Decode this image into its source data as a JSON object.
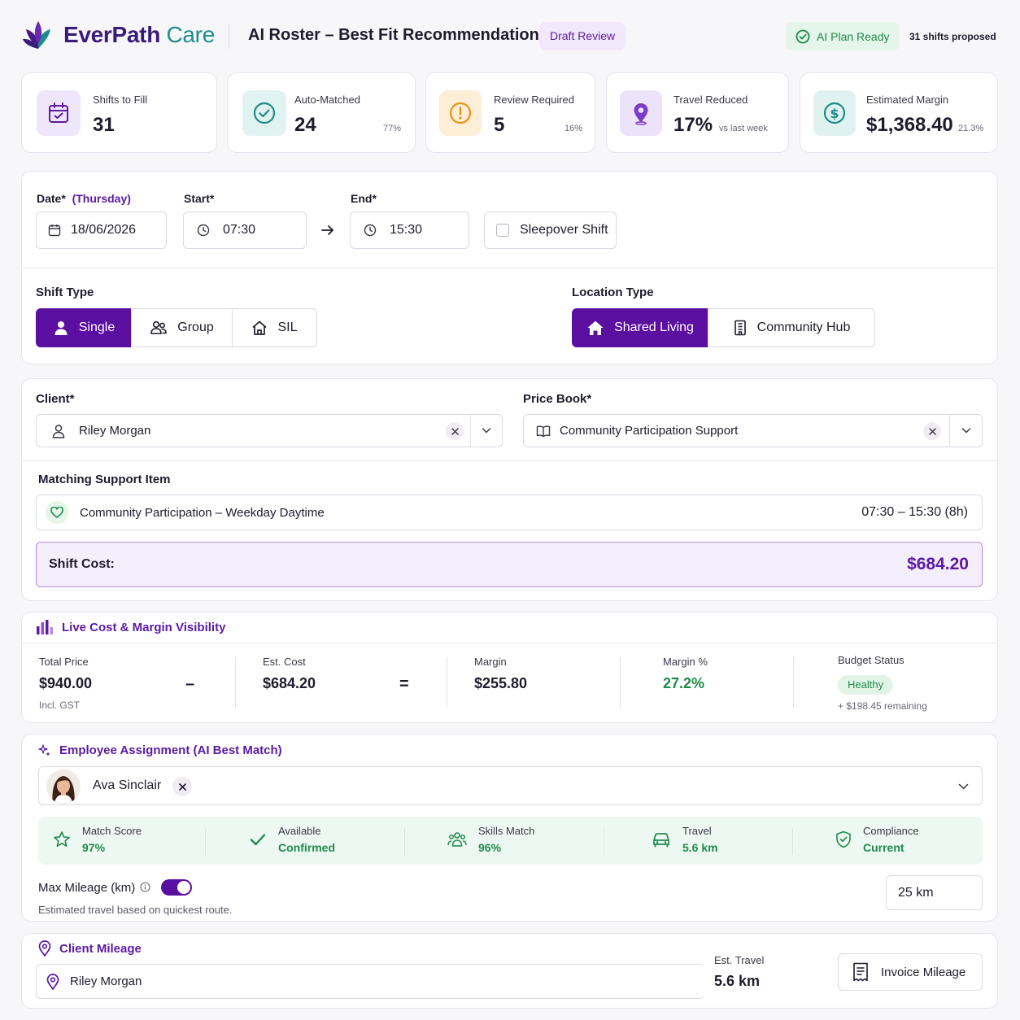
{
  "header": {
    "brand_first": "EverPath",
    "brand_second": "Care",
    "title": "AI Roster – Best Fit Recommendation",
    "draft_badge": "Draft Review",
    "ready_badge": "AI Plan Ready",
    "proposed": "31 shifts proposed"
  },
  "stats": [
    {
      "label": "Shifts to Fill",
      "value": "31",
      "sub": "",
      "icon": "calendar-icon"
    },
    {
      "label": "Auto-Matched",
      "value": "24",
      "sub": "77%",
      "icon": "check-circle-icon"
    },
    {
      "label": "Review Required",
      "value": "5",
      "sub": "16%",
      "icon": "alert-icon"
    },
    {
      "label": "Travel Reduced",
      "value": "17%",
      "sub": "vs last week",
      "icon": "location-pin-icon"
    },
    {
      "label": "Estimated Margin",
      "value": "$1,368.40",
      "sub": "21.3%",
      "icon": "dollar-icon"
    }
  ],
  "shift": {
    "date_label": "Date*",
    "day_label": "(Thursday)",
    "date_value": "18/06/2026",
    "start_label": "Start*",
    "start_value": "07:30",
    "end_label": "End*",
    "end_value": "15:30",
    "sleepover_label": "Sleepover Shift",
    "shift_type_label": "Shift Type",
    "shift_types": [
      "Single",
      "Group",
      "SIL"
    ],
    "location_type_label": "Location Type",
    "location_types": [
      "Shared Living",
      "Community Hub"
    ]
  },
  "client": {
    "label": "Client*",
    "value": "Riley Morgan",
    "price_book_label": "Price Book*",
    "price_book_value": "Community Participation Support",
    "support_item_label": "Matching Support Item",
    "support_item_value": "Community Participation – Weekday Daytime",
    "support_item_time": "07:30 – 15:30 (8h)",
    "shift_cost_label": "Shift Cost:",
    "shift_cost_value": "$684.20"
  },
  "costs": {
    "title": "Live Cost & Margin Visibility",
    "total_price_label": "Total Price",
    "total_price_value": "$940.00",
    "total_price_note": "Incl. GST",
    "minus": "–",
    "est_cost_label": "Est. Cost",
    "est_cost_value": "$684.20",
    "equals": "=",
    "margin_label": "Margin",
    "margin_value": "$255.80",
    "margin_pct_label": "Margin %",
    "margin_pct_value": "27.2%",
    "budget_label": "Budget Status",
    "budget_badge": "Healthy",
    "budget_remaining": "+ $198.45 remaining"
  },
  "employee": {
    "title": "Employee Assignment (AI Best Match)",
    "name": "Ava Sinclair",
    "metrics": [
      {
        "label": "Match Score",
        "value": "97%",
        "icon": "star-icon"
      },
      {
        "label": "Available",
        "value": "Confirmed",
        "icon": "check-icon"
      },
      {
        "label": "Skills Match",
        "value": "96%",
        "icon": "people-icon"
      },
      {
        "label": "Travel",
        "value": "5.6 km",
        "icon": "car-icon"
      },
      {
        "label": "Compliance",
        "value": "Current",
        "icon": "shield-check-icon"
      }
    ],
    "max_mileage_label": "Max Mileage (km)",
    "max_mileage_value": "25 km",
    "mileage_note": "Estimated travel based on quickest route.",
    "toggle_on": true
  },
  "mileage": {
    "title": "Client Mileage",
    "client": "Riley Morgan",
    "est_travel_label": "Est. Travel",
    "est_travel_value": "5.6 km",
    "invoice_button": "Invoice Mileage"
  },
  "colors": {
    "primary": "#5b0fa0",
    "brand_teal": "#1e8d8a",
    "success": "#1f8a4c",
    "warning": "#f5a623"
  }
}
